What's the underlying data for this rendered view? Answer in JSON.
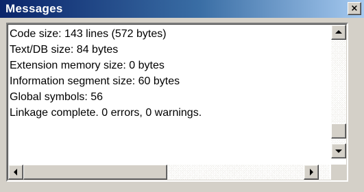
{
  "window": {
    "title": "Messages",
    "close_glyph": "×",
    "title_bar_colors": [
      "#0a246a",
      "#3a6ea5",
      "#a6caf0"
    ]
  },
  "messages": {
    "lines": [
      "Code size: 143 lines (572 bytes)",
      "Text/DB size: 84 bytes",
      "Extension memory size: 0 bytes",
      "Information segment size: 60 bytes",
      "Global symbols: 56",
      "Linkage complete. 0 errors, 0 warnings."
    ]
  },
  "icons": {
    "close": "close-icon",
    "scroll_up": "arrow-up-icon",
    "scroll_down": "arrow-down-icon",
    "scroll_left": "arrow-left-icon",
    "scroll_right": "arrow-right-icon"
  }
}
